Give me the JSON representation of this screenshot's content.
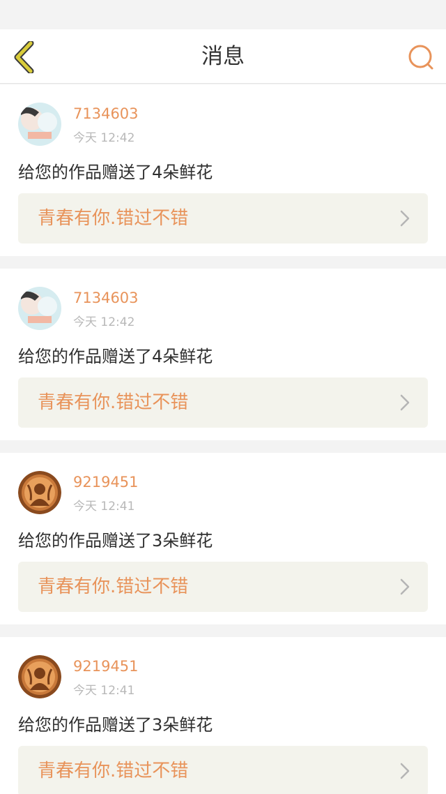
{
  "header": {
    "title": "消息"
  },
  "colors": {
    "accent": "#e8935a",
    "back_icon": "#c6b92f",
    "card_link_bg": "#f3f3ec"
  },
  "icons": {
    "back": "chevron-left-icon",
    "search": "search-icon",
    "link": "chevron-right-icon"
  },
  "messages": [
    {
      "avatar": "avatar-photo",
      "username": "7134603",
      "time": "今天 12:42",
      "text": "给您的作品赠送了4朵鲜花",
      "work_title": "青春有你.错过不错"
    },
    {
      "avatar": "avatar-photo",
      "username": "7134603",
      "time": "今天 12:42",
      "text": "给您的作品赠送了4朵鲜花",
      "work_title": "青春有你.错过不错"
    },
    {
      "avatar": "avatar-logo",
      "username": "9219451",
      "time": "今天 12:41",
      "text": "给您的作品赠送了3朵鲜花",
      "work_title": "青春有你.错过不错"
    },
    {
      "avatar": "avatar-logo",
      "username": "9219451",
      "time": "今天 12:41",
      "text": "给您的作品赠送了3朵鲜花",
      "work_title": "青春有你.错过不错"
    }
  ]
}
